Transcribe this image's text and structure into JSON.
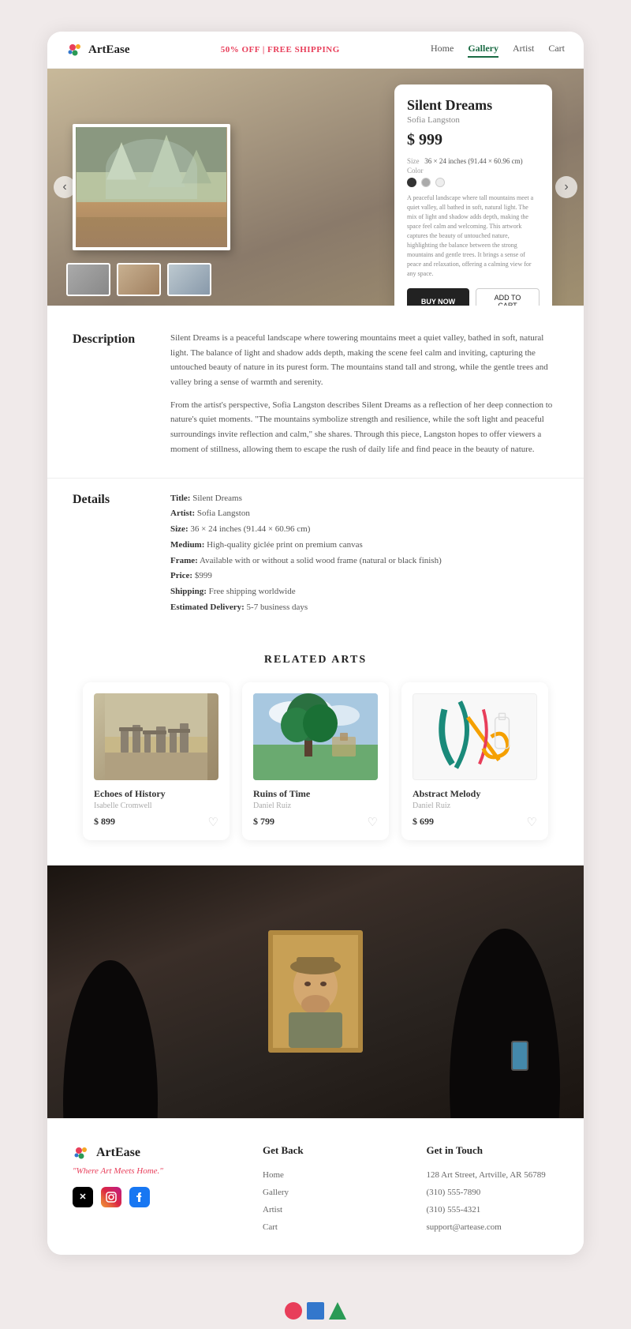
{
  "navbar": {
    "logo": "ArtEase",
    "promo": "50% OFF | FREE SHIPPING",
    "links": [
      "Home",
      "Gallery",
      "Artist",
      "Cart"
    ],
    "active": "Gallery"
  },
  "hero": {
    "prev_btn": "‹",
    "next_btn": "›",
    "card": {
      "title": "Silent Dreams",
      "artist": "Sofia Langston",
      "price": "$ 999",
      "size_label": "Size",
      "size_value": "36 × 24 inches (91.44 × 60.96 cm)",
      "color_label": "Color",
      "description": "A peaceful landscape where tall mountains meet a quiet valley, all bathed in soft, natural light. The mix of light and shadow adds depth, making the space feel calm and welcoming. This artwork captures the beauty of untouched nature, highlighting the balance between the strong mountains and gentle trees. It brings a sense of peace and relaxation, offering a calming view for any space.",
      "buy_label": "BUY NOW",
      "cart_label": "ADD TO CART"
    }
  },
  "description": {
    "label": "Description",
    "para1": "Silent Dreams is a peaceful landscape where towering mountains meet a quiet valley, bathed in soft, natural light. The balance of light and shadow adds depth, making the scene feel calm and inviting, capturing the untouched beauty of nature in its purest form. The mountains stand tall and strong, while the gentle trees and valley bring a sense of warmth and serenity.",
    "para2": "From the artist's perspective, Sofia Langston describes Silent Dreams as a reflection of her deep connection to nature's quiet moments. \"The mountains symbolize strength and resilience, while the soft light and peaceful surroundings invite reflection and calm,\" she shares. Through this piece, Langston hopes to offer viewers a moment of stillness, allowing them to escape the rush of daily life and find peace in the beauty of nature."
  },
  "details": {
    "label": "Details",
    "items": [
      {
        "key": "Title",
        "value": "Silent Dreams"
      },
      {
        "key": "Artist",
        "value": "Sofia Langston"
      },
      {
        "key": "Size",
        "value": "36 × 24 inches (91.44 × 60.96 cm)"
      },
      {
        "key": "Medium",
        "value": "High-quality giclée print on premium canvas"
      },
      {
        "key": "Frame",
        "value": "Available with or without a solid wood frame (natural or black finish)"
      },
      {
        "key": "Price",
        "value": "$999"
      },
      {
        "key": "Shipping",
        "value": "Free shipping worldwide"
      },
      {
        "key": "Estimated Delivery",
        "value": "5-7 business days"
      }
    ]
  },
  "related": {
    "section_title": "RELATED ARTS",
    "items": [
      {
        "title": "Echoes of History",
        "artist": "Isabelle Cromwell",
        "price": "$ 899",
        "type": "stones"
      },
      {
        "title": "Ruins of Time",
        "artist": "Daniel Ruiz",
        "price": "$ 799",
        "type": "landscape"
      },
      {
        "title": "Abstract Melody",
        "artist": "Daniel Ruiz",
        "price": "$ 699",
        "type": "abstract"
      }
    ]
  },
  "footer": {
    "brand": "ArtEase",
    "tagline": "\"Where Art Meets Home.\"",
    "get_back": {
      "title": "Get Back",
      "links": [
        "Home",
        "Gallery",
        "Artist",
        "Cart"
      ]
    },
    "get_in_touch": {
      "title": "Get in Touch",
      "address": "128 Art Street, Artville, AR 56789",
      "phone1": "(310) 555-7890",
      "phone2": "(310) 555-4321",
      "email": "support@artease.com"
    }
  },
  "bottom_bar": {
    "shapes": [
      {
        "type": "circle",
        "color": "#e83e5a"
      },
      {
        "type": "square",
        "color": "#3377cc"
      },
      {
        "type": "triangle",
        "color": "#2a9a55"
      }
    ]
  }
}
